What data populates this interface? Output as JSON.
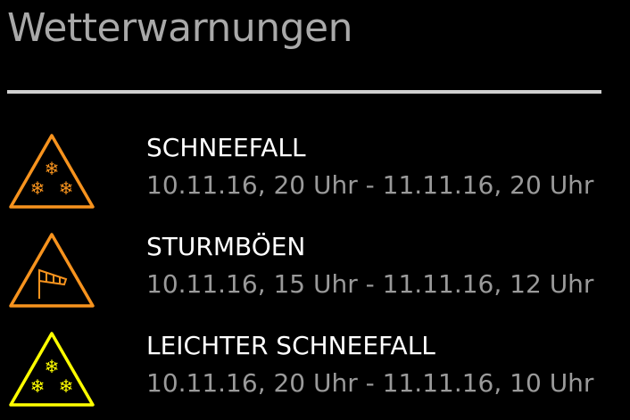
{
  "header": {
    "title": "Wetterwarnungen"
  },
  "colors": {
    "orange": "#f7931e",
    "yellow": "#ffff00"
  },
  "warnings": [
    {
      "event": "SCHNEEFALL",
      "period": "10.11.16, 20 Uhr - 11.11.16, 20 Uhr",
      "icon": "snowfall-warning-icon",
      "level_color": "#f7931e"
    },
    {
      "event": "STURMBÖEN",
      "period": "10.11.16, 15 Uhr - 11.11.16, 12 Uhr",
      "icon": "windsock-warning-icon",
      "level_color": "#f7931e"
    },
    {
      "event": "LEICHTER SCHNEEFALL",
      "period": "10.11.16, 20 Uhr - 11.11.16, 10 Uhr",
      "icon": "snowfall-warning-icon",
      "level_color": "#ffff00"
    }
  ]
}
